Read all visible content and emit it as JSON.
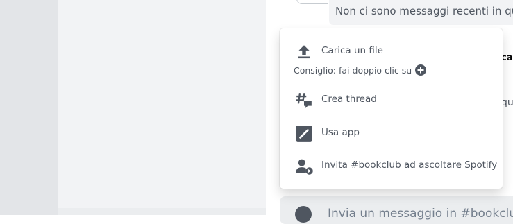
{
  "background": {
    "recent_messages_text": "Non ci sono messaggi recenti in qu",
    "peek_top": "ca",
    "peek_mid": "qu",
    "composer_placeholder": "Invia un messaggio in #bookclub"
  },
  "menu": {
    "upload_label": "Carica un file",
    "tip_text": "Consiglio: fai doppio clic su",
    "create_thread_label": "Crea thread",
    "use_app_label": "Usa app",
    "invite_label": "Invita #bookclub ad ascoltare Spotify"
  },
  "colors": {
    "icon": "#4f5660",
    "text": "#4f5660",
    "menu_bg": "#ffffff"
  },
  "icons": [
    "upload-icon",
    "plus-circle-icon",
    "thread-icon",
    "app-icon",
    "invite-spotify-icon"
  ]
}
